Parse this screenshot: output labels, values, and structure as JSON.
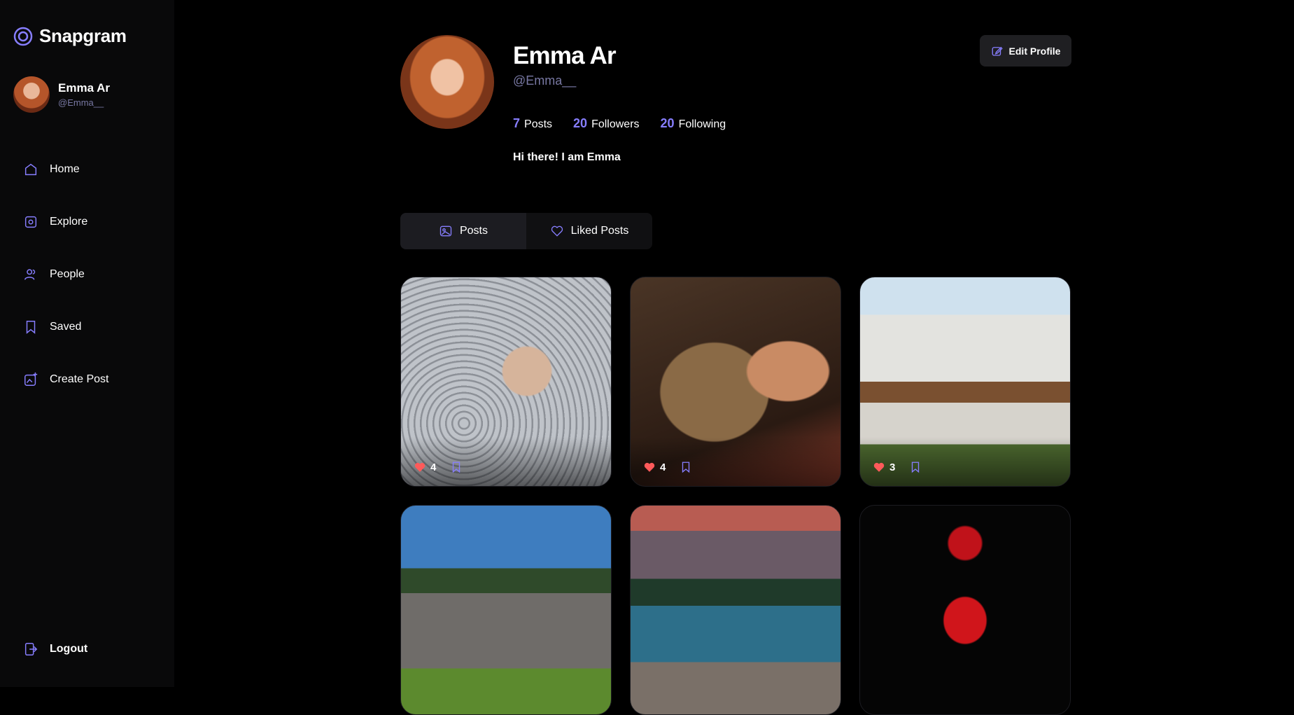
{
  "app": {
    "name": "Snapgram"
  },
  "current_user": {
    "name": "Emma Ar",
    "handle": "@Emma__"
  },
  "nav": [
    {
      "label": "Home",
      "icon": "home-icon"
    },
    {
      "label": "Explore",
      "icon": "explore-icon"
    },
    {
      "label": "People",
      "icon": "people-icon"
    },
    {
      "label": "Saved",
      "icon": "bookmark-icon"
    },
    {
      "label": "Create Post",
      "icon": "create-post-icon"
    }
  ],
  "logout_label": "Logout",
  "profile": {
    "name": "Emma Ar",
    "handle": "@Emma__",
    "posts_count": "7",
    "posts_label": "Posts",
    "followers_count": "20",
    "followers_label": "Followers",
    "following_count": "20",
    "following_label": "Following",
    "bio": "Hi there! I am Emma",
    "edit_label": "Edit Profile"
  },
  "tabs": [
    {
      "label": "Posts",
      "icon": "posts-icon"
    },
    {
      "label": "Liked Posts",
      "icon": "heart-icon"
    }
  ],
  "posts": [
    {
      "likes": "4",
      "subject": "cat being petted on stone pavement"
    },
    {
      "likes": "4",
      "subject": "girl hugging tabby cat"
    },
    {
      "likes": "3",
      "subject": "modern house with balcony"
    },
    {
      "likes": "",
      "subject": "modern stone house"
    },
    {
      "likes": "",
      "subject": "mountain lake at sunset"
    },
    {
      "likes": "",
      "subject": "red chess bishop"
    }
  ],
  "colors": {
    "accent": "#877eff",
    "like": "#ff5a5a",
    "muted": "#7878a3"
  }
}
